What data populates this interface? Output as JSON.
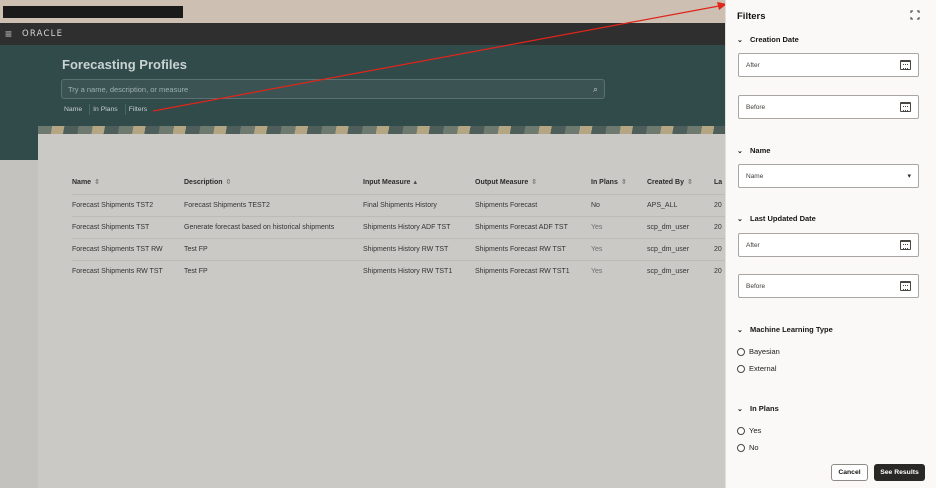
{
  "app": {
    "logo": "ORACLE",
    "page_title": "Forecasting Profiles",
    "search_placeholder": "Try a name, description, or measure",
    "chips": [
      "Name",
      "In Plans",
      "Filters"
    ]
  },
  "table": {
    "columns": [
      "Name",
      "Description",
      "Input Measure",
      "Output Measure",
      "In Plans",
      "Created By",
      "La"
    ],
    "sort_icons": [
      "⇳",
      "⇳",
      "▴",
      "⇳",
      "⇳",
      "⇳"
    ],
    "rows": [
      [
        "Forecast Shipments TST2",
        "Forecast Shipments TEST2",
        "Final Shipments History",
        "Shipments Forecast",
        "No",
        "APS_ALL",
        "20"
      ],
      [
        "Forecast Shipments TST",
        "Generate forecast based on historical shipments",
        "Shipments History ADF TST",
        "Shipments Forecast ADF TST",
        "Yes",
        "scp_dm_user",
        "20"
      ],
      [
        "Forecast Shipments TST RW",
        "Test FP",
        "Shipments History RW TST",
        "Shipments Forecast RW TST",
        "Yes",
        "scp_dm_user",
        "20"
      ],
      [
        "Forecast Shipments RW TST",
        "Test FP",
        "Shipments History RW TST1",
        "Shipments Forecast RW TST1",
        "Yes",
        "scp_dm_user",
        "20"
      ]
    ]
  },
  "filters": {
    "title": "Filters",
    "creation_date": {
      "label": "Creation Date",
      "after": "After",
      "before": "Before"
    },
    "name": {
      "label": "Name",
      "select": "Name"
    },
    "last_updated_date": {
      "label": "Last Updated Date",
      "after": "After",
      "before": "Before"
    },
    "ml_type": {
      "label": "Machine Learning Type",
      "options": [
        "Bayesian",
        "External"
      ]
    },
    "in_plans": {
      "label": "In Plans",
      "options": [
        "Yes",
        "No"
      ]
    },
    "cancel": "Cancel",
    "see_results": "See Results"
  },
  "colors": {
    "annotation_arrow": "#e0251b",
    "header": "#314a4a",
    "primary_button": "#2a2825"
  }
}
